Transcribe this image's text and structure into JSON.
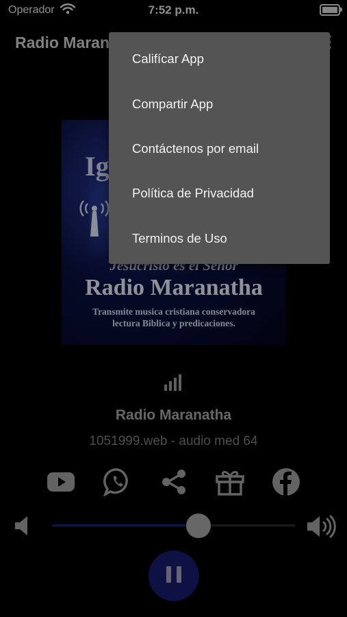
{
  "status_bar": {
    "carrier": "Operador",
    "time": "7:52 p.m."
  },
  "header": {
    "title": "Radio Maranatha"
  },
  "artwork": {
    "top_text": "Ig",
    "subtitle": "Jesucristo es el Señor",
    "title": "Radio Maranatha",
    "desc_line1": "Transmite musica cristiana conservadora",
    "desc_line2": "lectura Biblica y predicaciones."
  },
  "player": {
    "station_name": "Radio Maranatha",
    "station_info": "1051999.web - audio med 64",
    "volume_level": 0.6
  },
  "share_buttons": [
    "youtube-icon",
    "whatsapp-icon",
    "share-icon",
    "gift-icon",
    "facebook-icon"
  ],
  "menu": {
    "items": [
      {
        "label": "Califícar App"
      },
      {
        "label": "Compartir App"
      },
      {
        "label": "Contáctenos por email"
      },
      {
        "label": "Política de Privacidad"
      },
      {
        "label": "Terminos de Uso"
      }
    ]
  },
  "colors": {
    "accent": "#1d1e7c",
    "play_button": "#191a6e",
    "menu_bg": "#545454"
  }
}
